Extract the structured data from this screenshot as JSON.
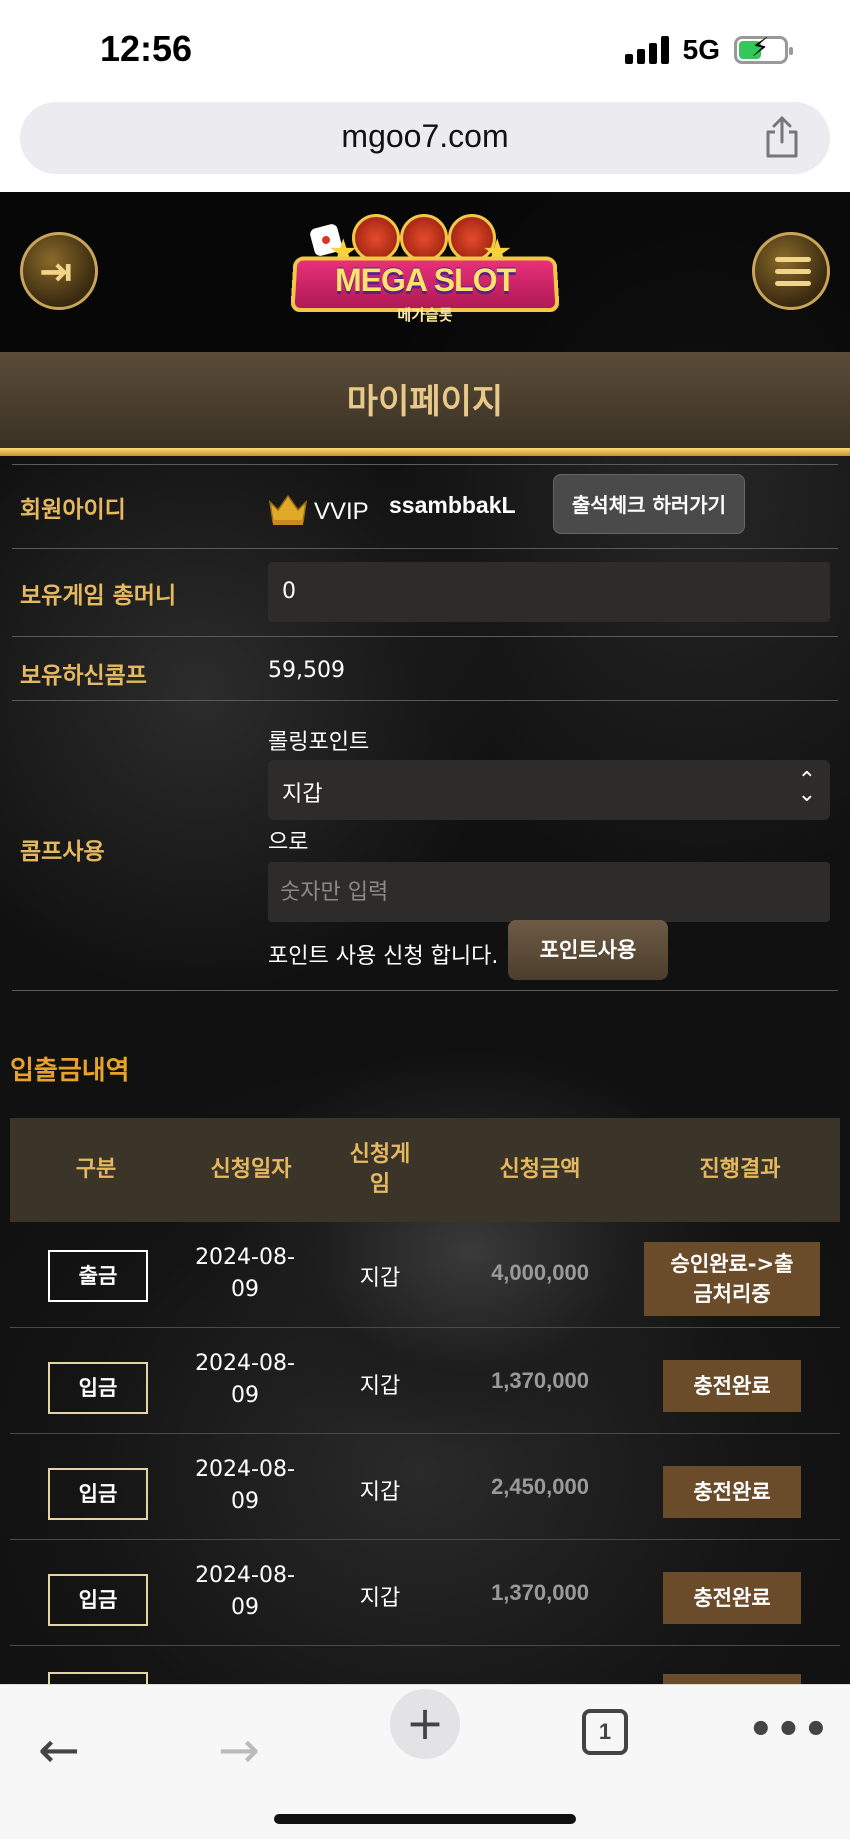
{
  "status_bar": {
    "time": "12:56",
    "network": "5G"
  },
  "browser": {
    "url": "mgoo7.com",
    "tab_count": "1"
  },
  "header": {
    "logo_text": "MEGA SLOT",
    "logo_sub": "메가슬롯",
    "page_title": "마이페이지"
  },
  "profile": {
    "member_id_label": "회원아이디",
    "vip_level": "VVIP",
    "user_id": "ssambbakL",
    "attendance_button": "출석체크 하러가기",
    "game_money_label": "보유게임 총머니",
    "game_money_value": "0",
    "comp_label": "보유하신콤프",
    "comp_value": "59,509",
    "comp_use_label": "콤프사용",
    "rolling_point_label": "롤링포인트",
    "wallet_select": "지갑",
    "to_label": "으로",
    "amount_placeholder": "숫자만 입력",
    "apply_text": "포인트 사용 신청 합니다.",
    "use_point_button": "포인트사용"
  },
  "history": {
    "title": "입출금내역",
    "columns": [
      "구분",
      "신청일자",
      "신청게\n임",
      "신청금액",
      "진행결과"
    ],
    "rows": [
      {
        "type": "출금",
        "date": "2024-08-\n09",
        "game": "지갑",
        "amount": "4,000,000",
        "result": "승인완료->출\n금처리중"
      },
      {
        "type": "입금",
        "date": "2024-08-\n09",
        "game": "지갑",
        "amount": "1,370,000",
        "result": "충전완료"
      },
      {
        "type": "입금",
        "date": "2024-08-\n09",
        "game": "지갑",
        "amount": "2,450,000",
        "result": "충전완료"
      },
      {
        "type": "입금",
        "date": "2024-08-\n09",
        "game": "지갑",
        "amount": "1,370,000",
        "result": "충전완료"
      }
    ]
  },
  "colors": {
    "accent_gold": "#e6b860",
    "history_orange": "#e8a32a",
    "result_brown": "#6a4b2a"
  }
}
